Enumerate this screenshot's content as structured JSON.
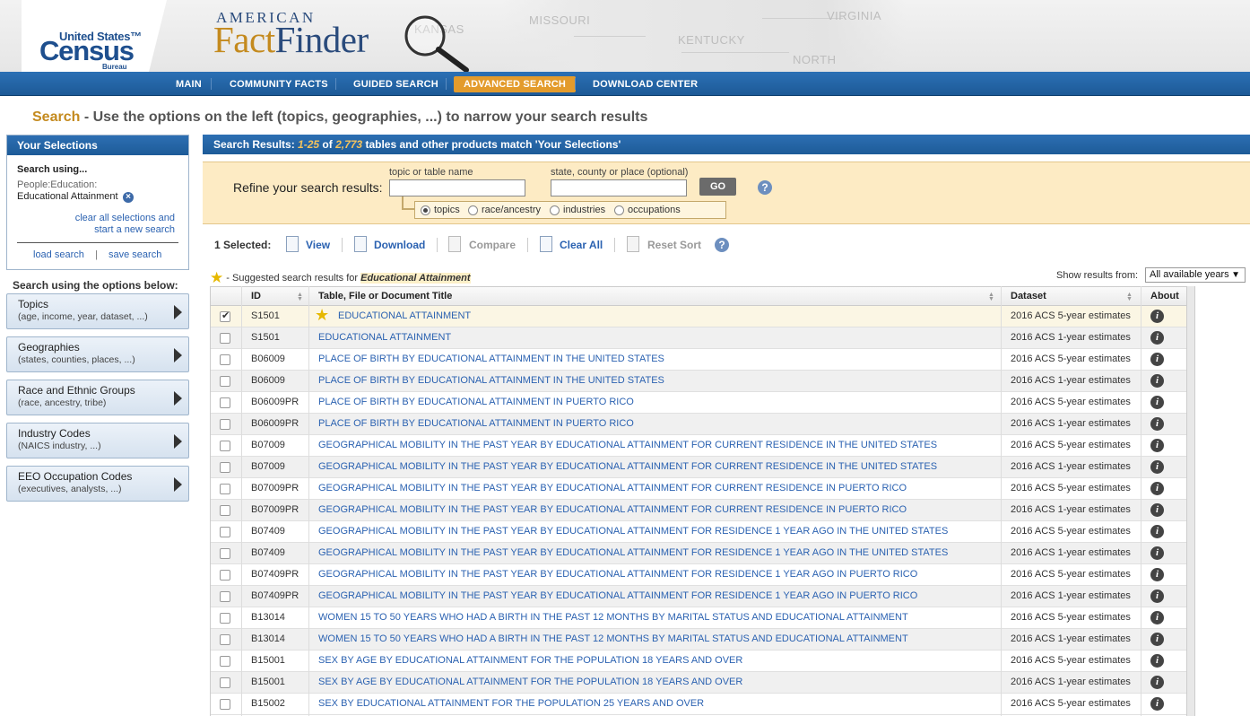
{
  "header": {
    "logo_us": "United States™",
    "logo_census": "Census",
    "logo_bureau": "Bureau",
    "brand_top": "AMERICAN",
    "brand_fact": "Fact",
    "brand_finder": "Finder",
    "map_labels": [
      "MISSOURI",
      "VIRGINIA",
      "KENTUCKY",
      "KANSAS",
      "NORTH"
    ]
  },
  "nav": {
    "items": [
      "MAIN",
      "COMMUNITY FACTS",
      "GUIDED SEARCH",
      "ADVANCED SEARCH",
      "DOWNLOAD CENTER"
    ],
    "active": "ADVANCED SEARCH"
  },
  "heading": {
    "search_word": "Search",
    "rest": " - Use the options on the left (topics, geographies, ...) to narrow your search results"
  },
  "selections": {
    "title": "Your Selections",
    "using": "Search using...",
    "category": "People:Education:",
    "value": "Educational Attainment",
    "clear_line1": "clear all selections and",
    "clear_line2": "start a new search",
    "load": "load search",
    "pipe": "|",
    "save": "save search"
  },
  "options": {
    "heading": "Search using the options below:",
    "items": [
      {
        "title": "Topics",
        "sub": "(age, income, year, dataset, ...)"
      },
      {
        "title": "Geographies",
        "sub": "(states, counties, places, ...)"
      },
      {
        "title": "Race and Ethnic Groups",
        "sub": "(race, ancestry, tribe)"
      },
      {
        "title": "Industry Codes",
        "sub": "(NAICS industry, ...)"
      },
      {
        "title": "EEO Occupation Codes",
        "sub": "(executives, analysts, ...)"
      }
    ]
  },
  "results": {
    "prefix": "Search Results: ",
    "range": "1-25",
    "of": " of ",
    "total": "2,773",
    "suffix": " tables and other products match 'Your Selections'"
  },
  "refine": {
    "label": "Refine your search results:",
    "topic_label": "topic or table name",
    "topic_value": "",
    "place_label": "state, county or place (optional)",
    "place_value": "",
    "go": "GO",
    "radios": [
      "topics",
      "race/ancestry",
      "industries",
      "occupations"
    ],
    "radio_selected": "topics"
  },
  "toolbar": {
    "selected": "1 Selected:",
    "view": "View",
    "download": "Download",
    "compare": "Compare",
    "clear_all": "Clear All",
    "reset_sort": "Reset Sort"
  },
  "suggest": {
    "text": " - Suggested search results for ",
    "term": "Educational Attainment"
  },
  "show_from": {
    "label": "Show results from:",
    "value": "All available years"
  },
  "table": {
    "headers": {
      "id": "ID",
      "title": "Table, File or Document Title",
      "dataset": "Dataset",
      "about": "About"
    },
    "rows": [
      {
        "id": "S1501",
        "title": "EDUCATIONAL ATTAINMENT",
        "ds": "2016 ACS 5-year estimates",
        "checked": true,
        "suggested": true
      },
      {
        "id": "S1501",
        "title": "EDUCATIONAL ATTAINMENT",
        "ds": "2016 ACS 1-year estimates"
      },
      {
        "id": "B06009",
        "title": "PLACE OF BIRTH BY EDUCATIONAL ATTAINMENT IN THE UNITED STATES",
        "ds": "2016 ACS 5-year estimates"
      },
      {
        "id": "B06009",
        "title": "PLACE OF BIRTH BY EDUCATIONAL ATTAINMENT IN THE UNITED STATES",
        "ds": "2016 ACS 1-year estimates"
      },
      {
        "id": "B06009PR",
        "title": "PLACE OF BIRTH BY EDUCATIONAL ATTAINMENT IN PUERTO RICO",
        "ds": "2016 ACS 5-year estimates"
      },
      {
        "id": "B06009PR",
        "title": "PLACE OF BIRTH BY EDUCATIONAL ATTAINMENT IN PUERTO RICO",
        "ds": "2016 ACS 1-year estimates"
      },
      {
        "id": "B07009",
        "title": "GEOGRAPHICAL MOBILITY IN THE PAST YEAR BY EDUCATIONAL ATTAINMENT FOR CURRENT RESIDENCE IN THE UNITED STATES",
        "ds": "2016 ACS 5-year estimates"
      },
      {
        "id": "B07009",
        "title": "GEOGRAPHICAL MOBILITY IN THE PAST YEAR BY EDUCATIONAL ATTAINMENT FOR CURRENT RESIDENCE IN THE UNITED STATES",
        "ds": "2016 ACS 1-year estimates"
      },
      {
        "id": "B07009PR",
        "title": "GEOGRAPHICAL MOBILITY IN THE PAST YEAR BY EDUCATIONAL ATTAINMENT FOR CURRENT RESIDENCE IN PUERTO RICO",
        "ds": "2016 ACS 5-year estimates"
      },
      {
        "id": "B07009PR",
        "title": "GEOGRAPHICAL MOBILITY IN THE PAST YEAR BY EDUCATIONAL ATTAINMENT FOR CURRENT RESIDENCE IN PUERTO RICO",
        "ds": "2016 ACS 1-year estimates"
      },
      {
        "id": "B07409",
        "title": "GEOGRAPHICAL MOBILITY IN THE PAST YEAR BY EDUCATIONAL ATTAINMENT FOR RESIDENCE 1 YEAR AGO IN THE UNITED STATES",
        "ds": "2016 ACS 5-year estimates"
      },
      {
        "id": "B07409",
        "title": "GEOGRAPHICAL MOBILITY IN THE PAST YEAR BY EDUCATIONAL ATTAINMENT FOR RESIDENCE 1 YEAR AGO IN THE UNITED STATES",
        "ds": "2016 ACS 1-year estimates"
      },
      {
        "id": "B07409PR",
        "title": "GEOGRAPHICAL MOBILITY IN THE PAST YEAR BY EDUCATIONAL ATTAINMENT FOR RESIDENCE 1 YEAR AGO IN PUERTO RICO",
        "ds": "2016 ACS 5-year estimates"
      },
      {
        "id": "B07409PR",
        "title": "GEOGRAPHICAL MOBILITY IN THE PAST YEAR BY EDUCATIONAL ATTAINMENT FOR RESIDENCE 1 YEAR AGO IN PUERTO RICO",
        "ds": "2016 ACS 1-year estimates"
      },
      {
        "id": "B13014",
        "title": "WOMEN 15 TO 50 YEARS WHO HAD A BIRTH IN THE PAST 12 MONTHS BY MARITAL STATUS AND EDUCATIONAL ATTAINMENT",
        "ds": "2016 ACS 5-year estimates"
      },
      {
        "id": "B13014",
        "title": "WOMEN 15 TO 50 YEARS WHO HAD A BIRTH IN THE PAST 12 MONTHS BY MARITAL STATUS AND EDUCATIONAL ATTAINMENT",
        "ds": "2016 ACS 1-year estimates"
      },
      {
        "id": "B15001",
        "title": "SEX BY AGE BY EDUCATIONAL ATTAINMENT FOR THE POPULATION 18 YEARS AND OVER",
        "ds": "2016 ACS 5-year estimates"
      },
      {
        "id": "B15001",
        "title": "SEX BY AGE BY EDUCATIONAL ATTAINMENT FOR THE POPULATION 18 YEARS AND OVER",
        "ds": "2016 ACS 1-year estimates"
      },
      {
        "id": "B15002",
        "title": "SEX BY EDUCATIONAL ATTAINMENT FOR THE POPULATION 25 YEARS AND OVER",
        "ds": "2016 ACS 5-year estimates"
      }
    ]
  },
  "colors": {
    "nav_blue": "#1d5a97",
    "active_tab": "#e39b2c",
    "link": "#2b62b1",
    "refine_bg": "#fdebc4",
    "gold": "#c48a1e"
  }
}
